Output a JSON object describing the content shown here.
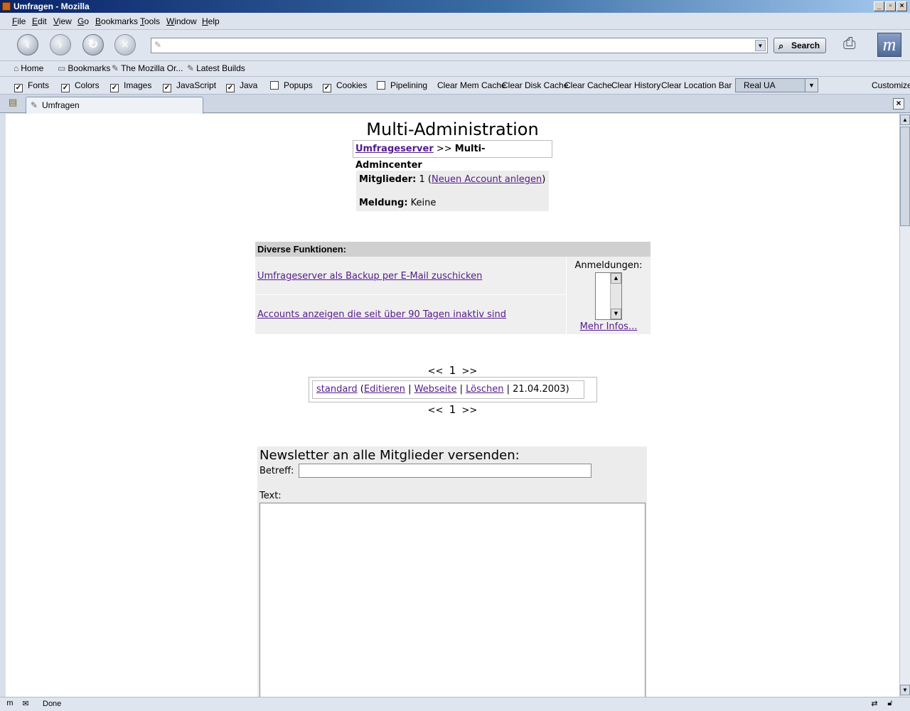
{
  "window": {
    "title": "Umfragen - Mozilla",
    "controls": [
      "_",
      "▫",
      "×"
    ]
  },
  "menu": [
    {
      "pre": "",
      "acc": "F",
      "post": "ile"
    },
    {
      "pre": "",
      "acc": "E",
      "post": "dit"
    },
    {
      "pre": "",
      "acc": "V",
      "post": "iew"
    },
    {
      "pre": "",
      "acc": "G",
      "post": "o"
    },
    {
      "pre": "",
      "acc": "B",
      "post": "ookmarks"
    },
    {
      "pre": "",
      "acc": "T",
      "post": "ools"
    },
    {
      "pre": "",
      "acc": "W",
      "post": "indow"
    },
    {
      "pre": "",
      "acc": "H",
      "post": "elp"
    }
  ],
  "nav": {
    "url_value": "",
    "search_label": "Search",
    "icons": [
      "back-icon",
      "forward-icon",
      "reload-icon",
      "stop-icon",
      "print-icon",
      "mozilla-logo-icon"
    ]
  },
  "personal_bar": {
    "home": "Home",
    "bookmarks": "Bookmarks",
    "mozilla_org": "The Mozilla Or...",
    "latest_builds": "Latest Builds"
  },
  "prefbar": {
    "checks": [
      {
        "label": "Fonts",
        "checked": true
      },
      {
        "label": "Colors",
        "checked": true
      },
      {
        "label": "Images",
        "checked": true
      },
      {
        "label": "JavaScript",
        "checked": true
      },
      {
        "label": "Java",
        "checked": true
      },
      {
        "label": "Popups",
        "checked": false
      },
      {
        "label": "Cookies",
        "checked": true
      },
      {
        "label": "Pipelining",
        "checked": false
      }
    ],
    "buttons": [
      "Clear Mem Cache",
      "Clear Disk Cache",
      "Clear Cache",
      "Clear History",
      "Clear Location Bar"
    ],
    "ua_select": "Real UA",
    "customize": "Customize"
  },
  "tab": {
    "label": "Umfragen"
  },
  "page": {
    "title": "Multi-Administration",
    "crumb_link": "Umfrageserver",
    "crumb_sep": " >> ",
    "crumb_current": "Multi-Admincenter",
    "members_label": "Mitglieder:",
    "members_count": " 1 (",
    "new_account": "Neuen Account anlegen",
    "members_close": ")",
    "message_label": "Meldung:",
    "message_value": " Keine",
    "functions_header": "Diverse Funktionen:",
    "func_backup": "Umfrageserver als Backup per E-Mail zuschicken",
    "func_inactive": "Accounts anzeigen die seit über 90 Tagen inaktiv sind",
    "registrations_label": "Anmeldungen:",
    "more_info": "Mehr Infos...",
    "pager_prev": "<<",
    "pager_page": "1",
    "pager_next": ">>",
    "record": {
      "name": "standard",
      "open_paren": " (",
      "edit": "Editieren",
      "sep1": " | ",
      "website": "Webseite",
      "sep2": " | ",
      "delete": "Löschen",
      "sep3": " | 21.04.2003)"
    },
    "newsletter_heading": "Newsletter an alle Mitglieder versenden:",
    "subject_label": "Betreff:",
    "subject_value": "",
    "text_label": "Text:",
    "text_value": ""
  },
  "status": {
    "text": "Done"
  }
}
